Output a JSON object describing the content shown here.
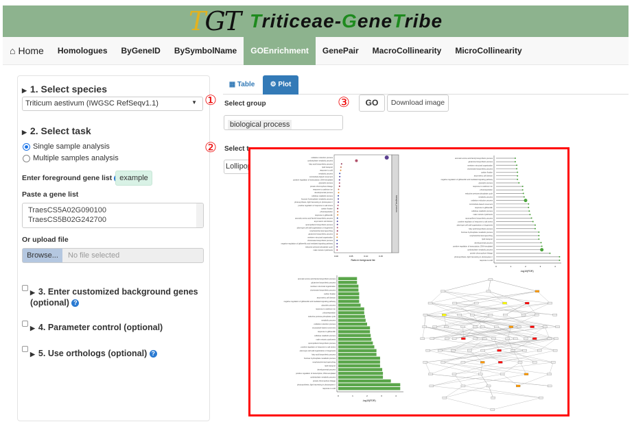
{
  "header": {
    "logo_letters": "TGT",
    "title_parts": [
      "T",
      "riticeae-",
      "G",
      "ene",
      "T",
      "ribe"
    ]
  },
  "nav": {
    "items": [
      {
        "label": "Home",
        "icon": "home-icon"
      },
      {
        "label": "Homologues"
      },
      {
        "label": "ByGeneID"
      },
      {
        "label": "BySymbolName"
      },
      {
        "label": "GOEnrichment",
        "active": true
      },
      {
        "label": "GenePair"
      },
      {
        "label": "MacroCollinearity"
      },
      {
        "label": "MicroCollinearity"
      }
    ]
  },
  "sidebar": {
    "species_title": "1. Select species",
    "species_value": "Triticum aestivum (IWGSC RefSeqv1.1)",
    "task_title": "2. Select task",
    "task_options": [
      {
        "label": "Single sample analysis",
        "checked": true
      },
      {
        "label": "Multiple samples analysis",
        "checked": false
      }
    ],
    "foreground_label": "Enter foreground gene list",
    "example_label": "example",
    "paste_label": "Paste a gene list",
    "genes": [
      "TraesCS5A02G090100",
      "TraesCS5B02G242700"
    ],
    "upload_label": "Or upload file",
    "browse_label": "Browse...",
    "file_placeholder": "No file selected",
    "optional": [
      {
        "label": "3. Enter customized background genes (optional)",
        "help": true
      },
      {
        "label": "4. Parameter control (optional)",
        "help": false
      },
      {
        "label": "5. Use orthologs (optional)",
        "help": true
      }
    ]
  },
  "main": {
    "tabs": [
      {
        "label": "Table",
        "icon": "table-icon"
      },
      {
        "label": "Plot",
        "icon": "gears-icon",
        "active": true
      }
    ],
    "select_group_label": "Select group",
    "group_value": "biological process",
    "select_type_label": "Select t",
    "plot_type_value": "Lollipop",
    "go_label": "GO",
    "download_label": "Download image",
    "annotations": [
      "①",
      "②",
      "③"
    ]
  },
  "colors": {
    "header": "#8db38e",
    "tab_active": "#337ab7",
    "bar": "#5aa64a",
    "annotation": "#ff0000"
  },
  "chart_data": [
    {
      "type": "scatter",
      "xlabel": "Ratio in foreground list",
      "facet": "biological_process",
      "xticks": [
        "0.00",
        "0.05",
        "0.10",
        "0.15"
      ],
      "categories": [
        "oxidation reduction process",
        "carbohydrate metabolic process",
        "fatty acid biosynthetic process",
        "lipid transport",
        "response to cold",
        "metabolic process",
        "microtubule-based movement",
        "positive regulation of transcription, DNA-templated",
        "glycolytic process",
        "protein-chromophore linkage",
        "response to cadmium ion",
        "developmental process",
        "cellulose catabolic process",
        "fructose 6-phosphate metabolic process",
        "photosynthesis, light harvesting in photosystem I",
        "positive regulation of response to salt stress",
        "carbon fixation",
        "photorespiration",
        "response to gibberellin",
        "aromatic amino acid family biosynthetic process",
        "asymmetric cell division",
        "sporopollenin biosynthetic process",
        "plant-type cell wall organization or biogenesis",
        "nonphotochemical quenching",
        "glutamine biosynthetic process",
        "meristem structural organization",
        "chorismate biosynthetic process",
        "negative regulation of gibberellic acid mediated signaling pathway",
        "reductive pentose-phosphate cycle",
        "male meiosis cytokinesis"
      ],
      "values": [
        0.17,
        0.068,
        0.018,
        0.016,
        0.015,
        0.012,
        0.012,
        0.011,
        0.011,
        0.011,
        0.008,
        0.008,
        0.007,
        0.007,
        0.007,
        0.006,
        0.005,
        0.005,
        0.005,
        0.004,
        0.004,
        0.004,
        0.004,
        0.004,
        0.003,
        0.003,
        0.003,
        0.003,
        0.003,
        0.003
      ]
    },
    {
      "type": "lollipop",
      "xlabel": "-log10(FDR)",
      "xticks": [
        "0",
        "1",
        "2",
        "3",
        "4"
      ],
      "categories": [
        "aromatic amino acid family biosynthetic process",
        "glutamine biosynthetic process",
        "meristem structural organization",
        "chorismate biosynthetic process",
        "carbon fixation",
        "asymmetric cell division",
        "negative regulation of gibberellic acid mediated signaling pathway",
        "glycolytic process",
        "response to cadmium ion",
        "photorespiration",
        "reductive pentose-phosphate cycle",
        "metabolic process",
        "oxidation reduction process",
        "microtubule-based movement",
        "response to gibberellin",
        "cellulose catabolic process",
        "male meiosis cytokinesis",
        "sporopollenin biosynthetic process",
        "positive regulation of response to salt stress",
        "plant-type cell wall organization or biogenesis",
        "fatty acid biosynthetic process",
        "fructose 6-phosphate metabolic process",
        "nonphotochemical quenching",
        "lipid transport",
        "developmental process",
        "positive regulation of transcription, DNA-templated",
        "carbohydrate metabolic process",
        "protein-chromophore linkage",
        "photosynthesis, light harvesting in photosystem I",
        "response to cold"
      ],
      "values": [
        1.3,
        1.3,
        1.4,
        1.4,
        1.45,
        1.45,
        1.45,
        1.55,
        1.8,
        1.8,
        1.85,
        1.9,
        2.0,
        2.2,
        2.2,
        2.25,
        2.3,
        2.4,
        2.5,
        2.65,
        2.65,
        2.9,
        2.9,
        2.9,
        3.05,
        3.1,
        3.1,
        3.65,
        4.3,
        4.3
      ]
    },
    {
      "type": "bar",
      "orientation": "horizontal",
      "xlabel": "-log10(FDR)",
      "xticks": [
        "0",
        "1",
        "2",
        "3",
        "4"
      ],
      "uses_categories_of": 1,
      "values": [
        1.3,
        1.3,
        1.4,
        1.4,
        1.45,
        1.45,
        1.45,
        1.55,
        1.8,
        1.8,
        1.85,
        1.9,
        2.0,
        2.2,
        2.2,
        2.25,
        2.3,
        2.4,
        2.5,
        2.65,
        2.65,
        2.9,
        2.9,
        2.9,
        3.05,
        3.1,
        3.1,
        3.65,
        4.3,
        4.3
      ]
    },
    {
      "type": "diagram",
      "kind": "GO DAG",
      "highlight_colors": [
        "#ffff00",
        "#ff9900",
        "#ff0000"
      ]
    }
  ]
}
